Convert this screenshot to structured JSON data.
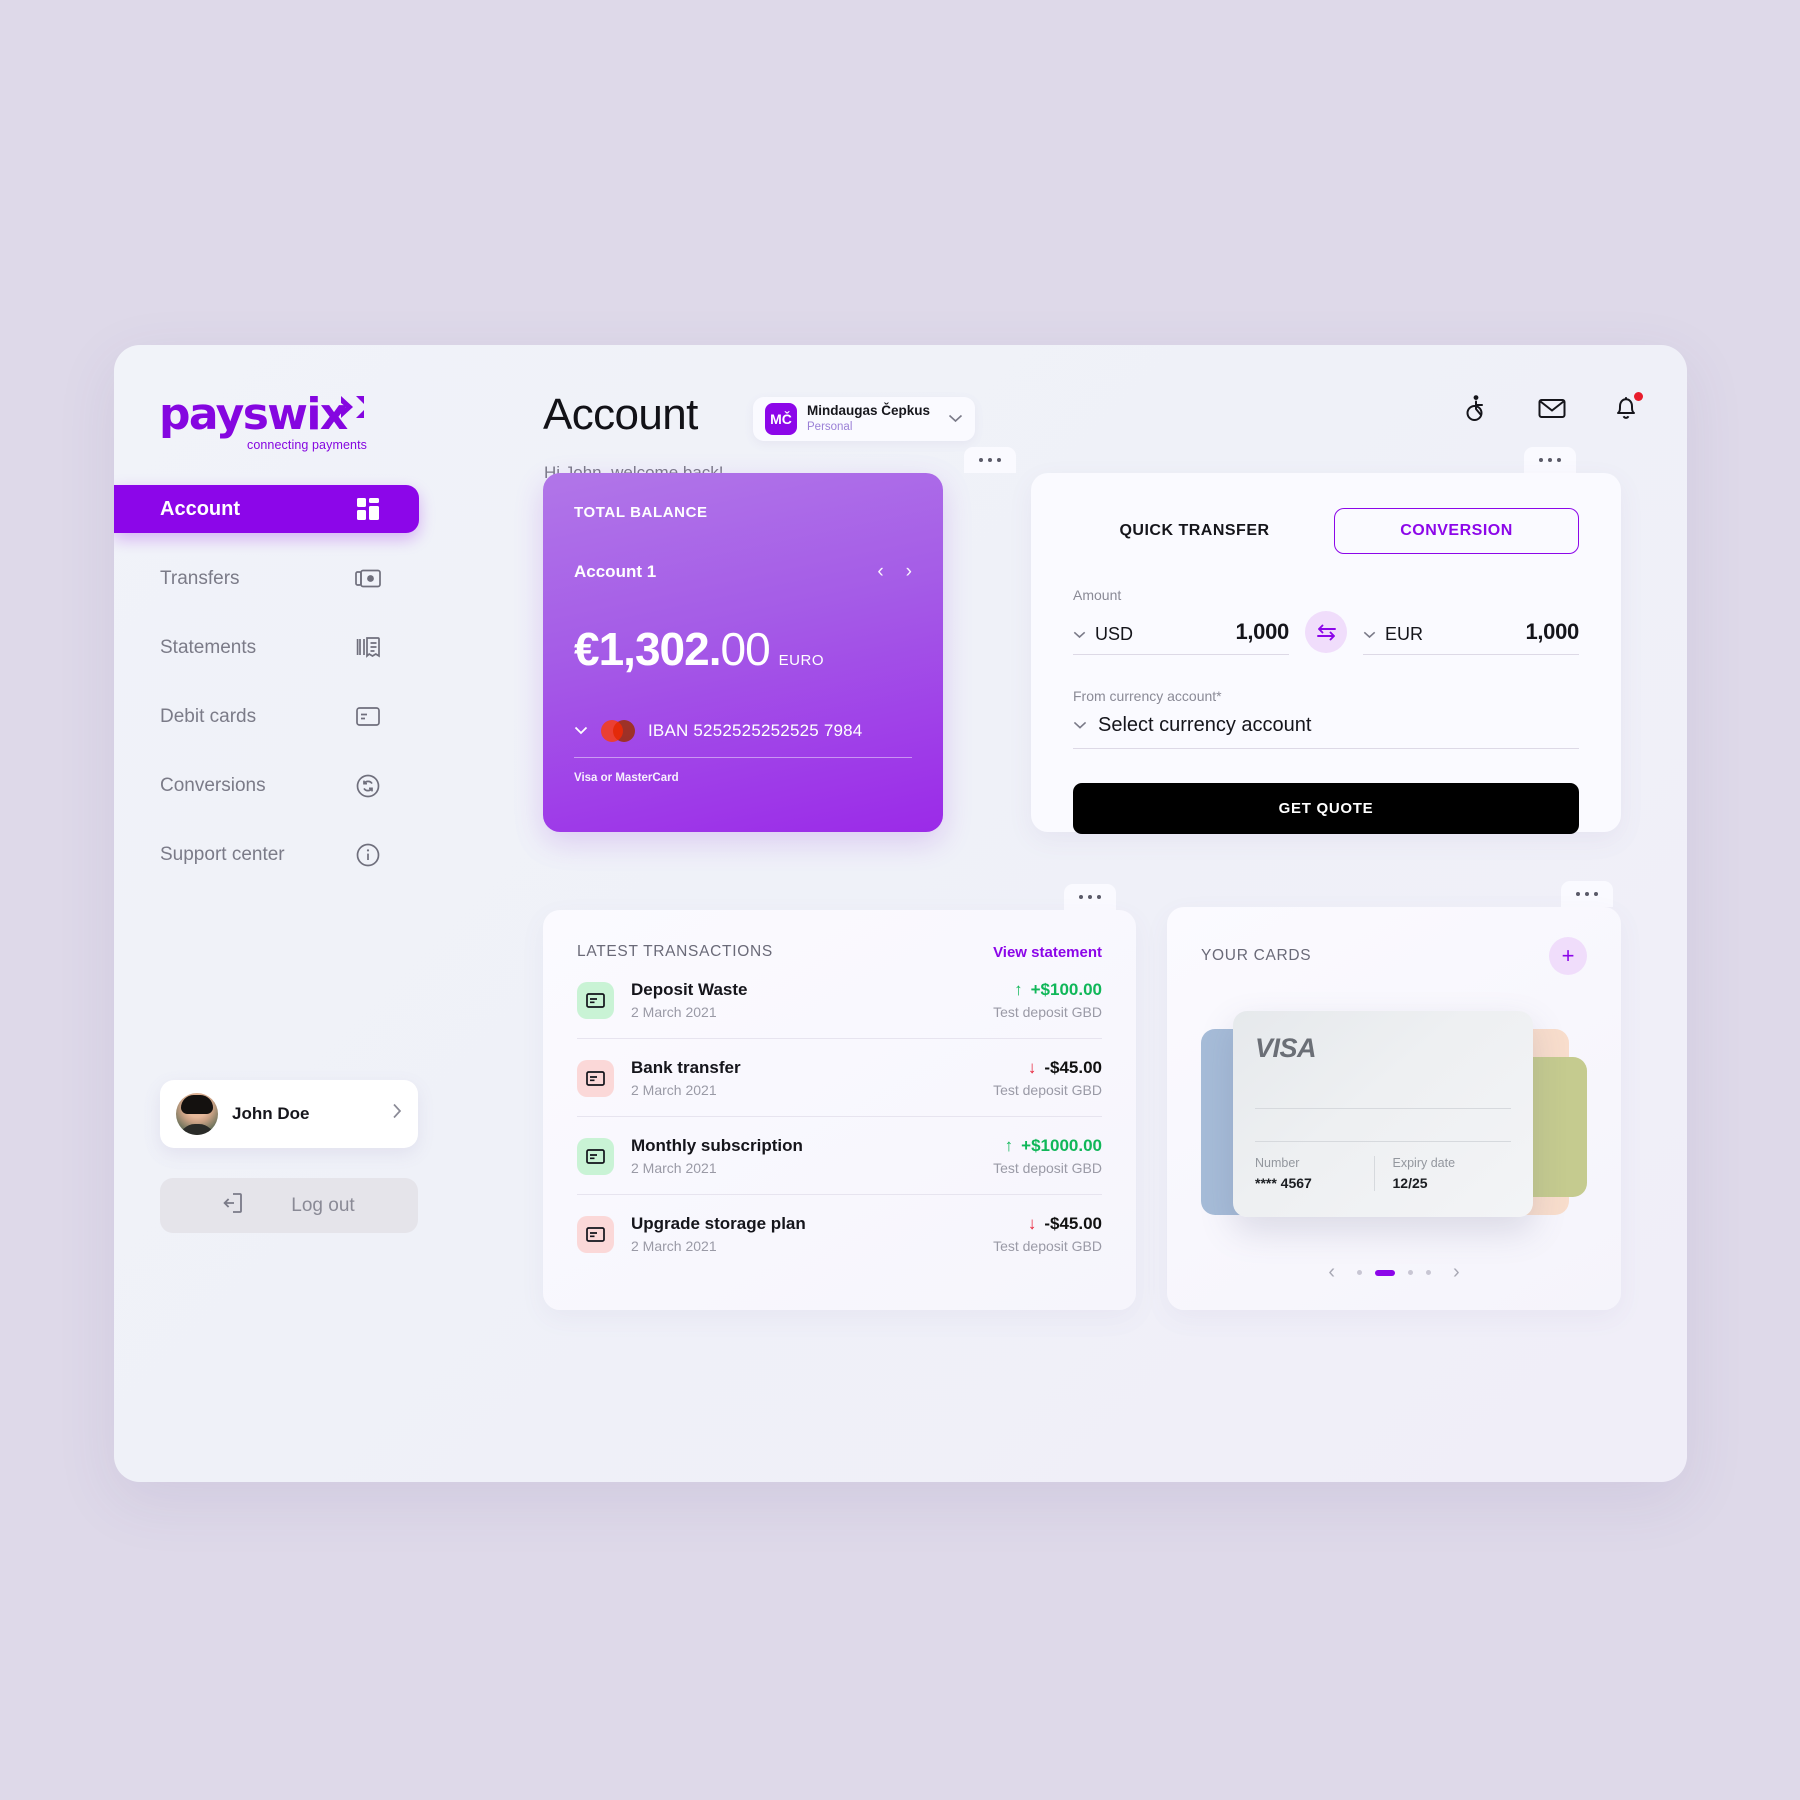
{
  "brand": {
    "logo_word": "payswix",
    "logo_tagline": "connecting payments",
    "accent": "#8c06e9"
  },
  "sidebar": {
    "items": [
      {
        "label": "Account",
        "icon": "grid-icon",
        "active": true
      },
      {
        "label": "Transfers",
        "icon": "banknotes-icon",
        "active": false
      },
      {
        "label": "Statements",
        "icon": "receipt-icon",
        "active": false
      },
      {
        "label": "Debit cards",
        "icon": "card-icon",
        "active": false
      },
      {
        "label": "Conversions",
        "icon": "currency-exchange-icon",
        "active": false
      },
      {
        "label": "Support center",
        "icon": "info-icon",
        "active": false
      }
    ],
    "profile": {
      "name": "John Doe",
      "chevron": "chevron-right-icon"
    },
    "logout": {
      "label": "Log out",
      "icon": "logout-icon"
    }
  },
  "header": {
    "title": "Account",
    "welcome": "Hi John, welcome back!",
    "account_switcher": {
      "initials": "MČ",
      "name": "Mindaugas Čepkus",
      "type": "Personal",
      "chevron": "chevron-down-icon"
    },
    "icons": [
      "accessibility-icon",
      "mail-icon",
      "bell-icon"
    ]
  },
  "balance_card": {
    "label": "TOTAL BALANCE",
    "account": "Account 1",
    "amount_main": "€1,302.",
    "amount_cents": "00",
    "currency": "EURO",
    "iban": "IBAN 5252525252525 7984",
    "note": "Visa or MasterCard",
    "prev": "‹",
    "next": "›"
  },
  "transfer_panel": {
    "tab_quick": "QUICK TRANSFER",
    "tab_conversion": "CONVERSION",
    "amount_label": "Amount",
    "from_currency": "USD",
    "from_value": "1,000",
    "to_currency": "EUR",
    "to_value": "1,000",
    "swap_icon": "swap-horizontal-icon",
    "account_label": "From currency account*",
    "account_value": "Select currency account",
    "button": "GET QUOTE"
  },
  "transactions": {
    "title": "LATEST TRANSACTIONS",
    "link": "View statement",
    "rows": [
      {
        "name": "Deposit Waste",
        "date": "2 March 2021",
        "amount": "+$100.00",
        "direction": "pos",
        "arrow": "↑",
        "sub": "Test deposit GBD"
      },
      {
        "name": "Bank transfer",
        "date": "2 March 2021",
        "amount": "-$45.00",
        "direction": "neg",
        "arrow": "↓",
        "sub": "Test deposit GBD"
      },
      {
        "name": "Monthly subscription",
        "date": "2 March 2021",
        "amount": "+$1000.00",
        "direction": "pos",
        "arrow": "↑",
        "sub": "Test deposit GBD"
      },
      {
        "name": "Upgrade storage plan",
        "date": "2 March 2021",
        "amount": "-$45.00",
        "direction": "neg",
        "arrow": "↓",
        "sub": "Test deposit GBD"
      }
    ]
  },
  "cards_panel": {
    "title": "YOUR CARDS",
    "add_label": "+",
    "card": {
      "brand": "VISA",
      "number_label": "Number",
      "number_value": "**** 4567",
      "expiry_label": "Expiry date",
      "expiry_value": "12/25"
    },
    "carousel": {
      "prev": "‹",
      "next": "›",
      "dots": 4,
      "active_dot": 1
    }
  }
}
